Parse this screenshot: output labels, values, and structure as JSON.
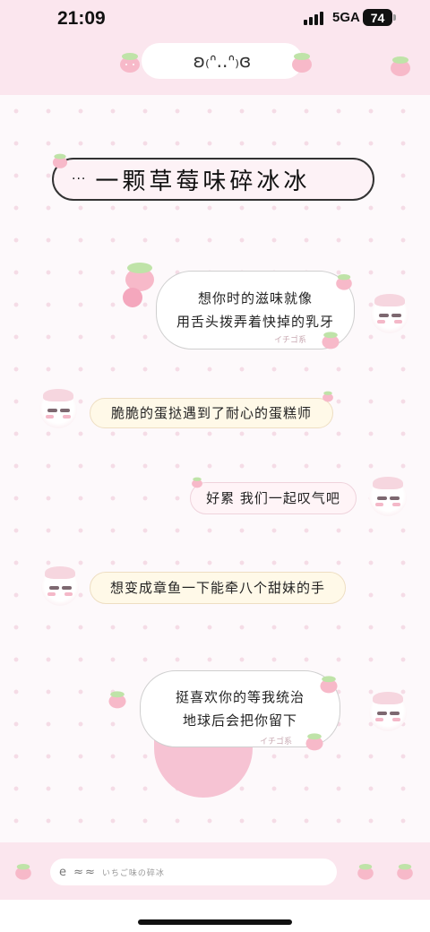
{
  "status_bar": {
    "time": "21:09",
    "network": "5GA",
    "battery": "74"
  },
  "header": {
    "title": "ʚ₍ᐢ..ᐢ₎ɞ"
  },
  "group_banner": {
    "dots": "···",
    "title": "一颗草莓味碎冰冰"
  },
  "messages": [
    {
      "side": "right",
      "lines": [
        "想你时的滋味就像",
        "用舌头拨弄着快掉的乳牙"
      ]
    },
    {
      "side": "left",
      "text": "脆脆的蛋挞遇到了耐心的蛋糕师"
    },
    {
      "side": "right",
      "text": "好累 我们一起叹气吧"
    },
    {
      "side": "left",
      "text": "想变成章鱼一下能牵八个甜妹的手"
    },
    {
      "side": "right",
      "lines": [
        "挺喜欢你的等我统治",
        "地球后会把你留下"
      ]
    }
  ],
  "watermark": "イチゴ系",
  "input": {
    "icon": "e ≈≈",
    "placeholder": "いちご味の碎冰"
  },
  "colors": {
    "header_bg": "#fbe6ee",
    "dot": "#f5dce6",
    "strawberry": "#f4a7bd",
    "leaf": "#bfe3a8"
  }
}
